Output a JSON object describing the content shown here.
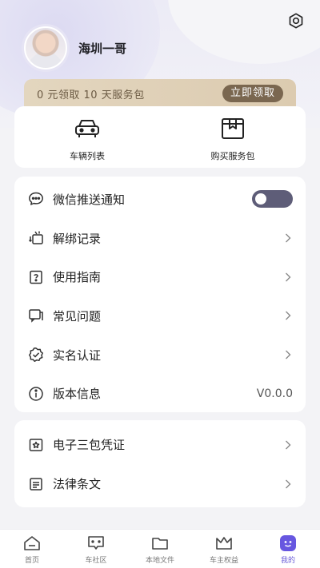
{
  "profile": {
    "username": "海圳一哥"
  },
  "promo": {
    "text": "0 元领取 10 天服务包",
    "button": "立即领取"
  },
  "quick_actions": [
    {
      "label": "车辆列表",
      "icon": "car-icon"
    },
    {
      "label": "购买服务包",
      "icon": "service-package-icon"
    }
  ],
  "menu": [
    {
      "label": "微信推送通知",
      "icon": "wechat-chat-icon",
      "control": "toggle",
      "toggle_on": false
    },
    {
      "label": "解绑记录",
      "icon": "unbind-icon"
    },
    {
      "label": "使用指南",
      "icon": "guide-icon"
    },
    {
      "label": "常见问题",
      "icon": "faq-icon"
    },
    {
      "label": "实名认证",
      "icon": "verified-badge-icon"
    },
    {
      "label": "版本信息",
      "icon": "info-icon",
      "value": "V0.0.0"
    }
  ],
  "menu2": [
    {
      "label": "电子三包凭证",
      "icon": "certificate-icon"
    },
    {
      "label": "法律条文",
      "icon": "document-icon"
    }
  ],
  "tabs": [
    {
      "label": "首页",
      "icon": "home-icon"
    },
    {
      "label": "车社区",
      "icon": "community-icon"
    },
    {
      "label": "本地文件",
      "icon": "folder-icon"
    },
    {
      "label": "车主权益",
      "icon": "crown-icon"
    },
    {
      "label": "我的",
      "icon": "profile-icon",
      "active": true
    }
  ],
  "colors": {
    "accent": "#6757e0",
    "promo_bg": "#e3d6bf",
    "promo_button": "#7a6750",
    "toggle": "#5e5d78"
  }
}
